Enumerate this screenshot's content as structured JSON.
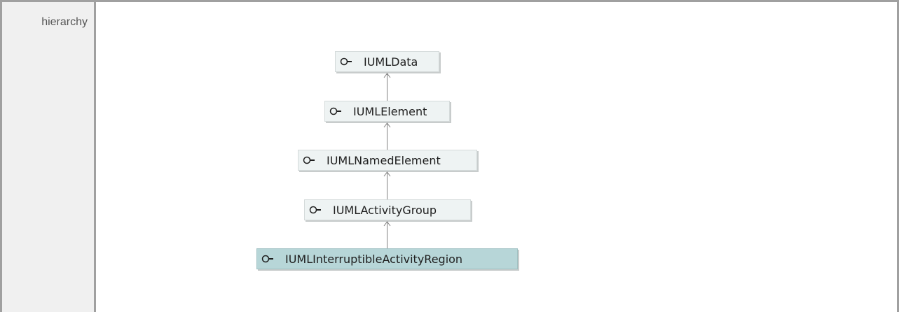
{
  "row": {
    "label": "hierarchy"
  },
  "hierarchy": {
    "nodes": [
      {
        "id": "n0",
        "label": "IUMLData",
        "icon": "interface-lollipop-icon",
        "selected": false
      },
      {
        "id": "n1",
        "label": "IUMLElement",
        "icon": "interface-lollipop-icon",
        "selected": false
      },
      {
        "id": "n2",
        "label": "IUMLNamedElement",
        "icon": "interface-lollipop-icon",
        "selected": false
      },
      {
        "id": "n3",
        "label": "IUMLActivityGroup",
        "icon": "interface-lollipop-icon",
        "selected": false
      },
      {
        "id": "n4",
        "label": "IUMLInterruptibleActivityRegion",
        "icon": "interface-lollipop-icon",
        "selected": true
      }
    ],
    "edges": [
      {
        "from": "IUMLElement",
        "to": "IUMLData",
        "type": "generalization"
      },
      {
        "from": "IUMLNamedElement",
        "to": "IUMLElement",
        "type": "generalization"
      },
      {
        "from": "IUMLActivityGroup",
        "to": "IUMLNamedElement",
        "type": "generalization"
      },
      {
        "from": "IUMLInterruptibleActivityRegion",
        "to": "IUMLActivityGroup",
        "type": "generalization"
      }
    ],
    "colors": {
      "node_fill": "#eef3f3",
      "selected_fill": "#b7d6d8",
      "connector": "#808080"
    }
  }
}
